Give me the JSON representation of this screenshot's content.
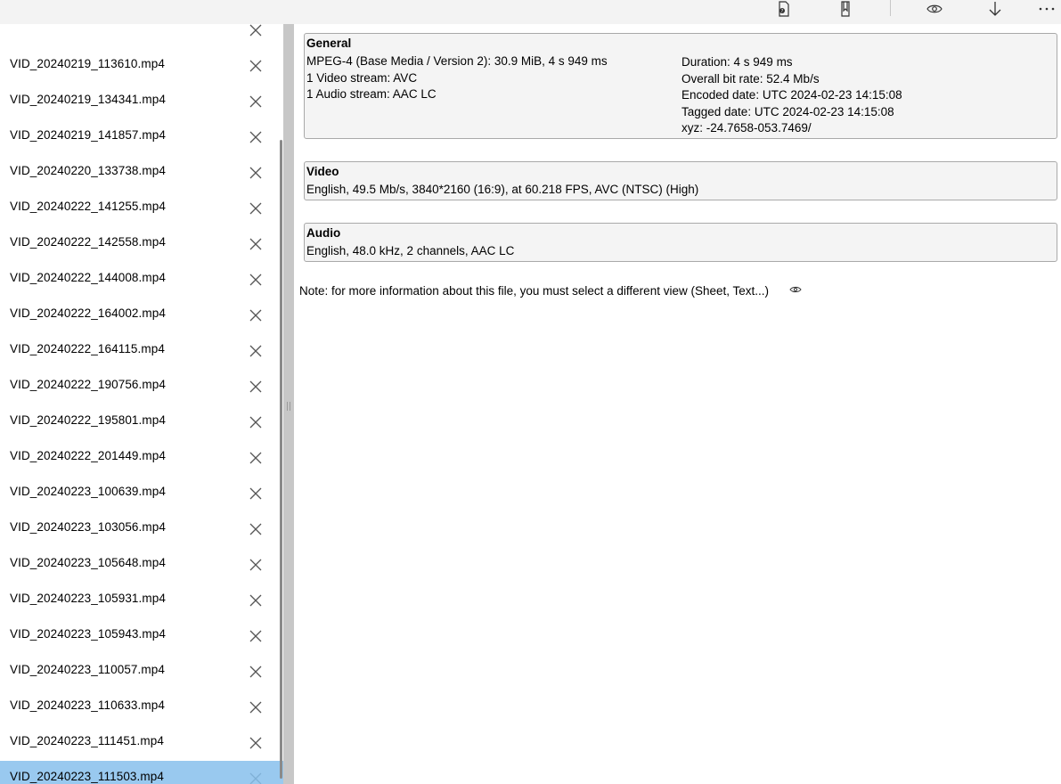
{
  "toolbar": {
    "icons": [
      "file-info-icon",
      "file-bookmark-icon",
      "eye-icon",
      "down-arrow-icon",
      "more-icon"
    ]
  },
  "files": [
    "VID_20240219_113610.mp4",
    "VID_20240219_134341.mp4",
    "VID_20240219_141857.mp4",
    "VID_20240220_133738.mp4",
    "VID_20240222_141255.mp4",
    "VID_20240222_142558.mp4",
    "VID_20240222_144008.mp4",
    "VID_20240222_164002.mp4",
    "VID_20240222_164115.mp4",
    "VID_20240222_190756.mp4",
    "VID_20240222_195801.mp4",
    "VID_20240222_201449.mp4",
    "VID_20240223_100639.mp4",
    "VID_20240223_103056.mp4",
    "VID_20240223_105648.mp4",
    "VID_20240223_105931.mp4",
    "VID_20240223_105943.mp4",
    "VID_20240223_110057.mp4",
    "VID_20240223_110633.mp4",
    "VID_20240223_111451.mp4",
    "VID_20240223_111503.mp4"
  ],
  "selected_file": "VID_20240223_111503.mp4",
  "general": {
    "title": "General",
    "left": [
      "MPEG-4 (Base Media / Version 2): 30.9 MiB, 4 s 949 ms",
      "1 Video stream: AVC",
      "1 Audio stream: AAC LC"
    ],
    "right": [
      "Duration: 4 s 949 ms",
      "Overall bit rate: 52.4 Mb/s",
      "Encoded date: UTC 2024-02-23 14:15:08",
      "Tagged date: UTC 2024-02-23 14:15:08",
      "xyz: -24.7658-053.7469/"
    ]
  },
  "video": {
    "title": "Video",
    "line": "English, 49.5 Mb/s, 3840*2160 (16:9), at 60.218 FPS, AVC (NTSC) (High)"
  },
  "audio": {
    "title": "Audio",
    "line": "English, 48.0 kHz, 2 channels, AAC LC"
  },
  "note": "Note: for more information about this file, you must select a different view (Sheet, Text...)",
  "colors": {
    "selected_row": "#99c9ef",
    "section_bg": "#f4f4f4",
    "splitter": "#c7c7c7"
  }
}
